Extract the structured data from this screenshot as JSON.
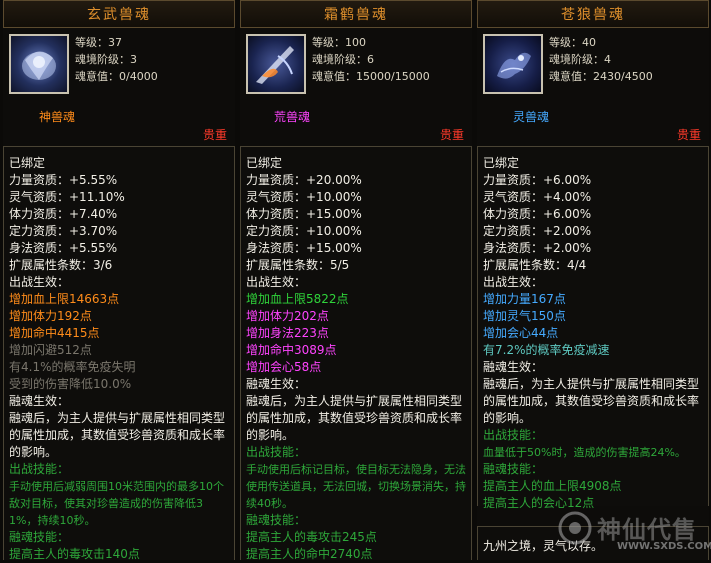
{
  "panels": [
    {
      "title": "玄武兽魂",
      "icon": "black-tortoise-beast-soul-icon",
      "level_label": "等级：37",
      "realm_label": "魂境阶级：3",
      "will_label": "魂意值：0/4000",
      "type_label": "神兽魂",
      "quality_label": "贵重",
      "lines": [
        {
          "text": "已绑定",
          "color": "white"
        },
        {
          "text": "力量资质：+5.55%",
          "color": "white"
        },
        {
          "text": "灵气资质：+11.10%",
          "color": "white"
        },
        {
          "text": "体力资质：+7.40%",
          "color": "white"
        },
        {
          "text": "定力资质：+3.70%",
          "color": "white"
        },
        {
          "text": "身法资质：+5.55%",
          "color": "white"
        },
        {
          "text": "扩展属性条数：3/6",
          "color": "white"
        },
        {
          "text": "出战生效：",
          "color": "white"
        },
        {
          "text": "增加血上限14663点",
          "color": "orange"
        },
        {
          "text": "增加体力192点",
          "color": "orange"
        },
        {
          "text": "增加命中4415点",
          "color": "orange"
        },
        {
          "text": "增加闪避512点",
          "color": "gray"
        },
        {
          "text": "有4.1%的概率免疫失明",
          "color": "gray"
        },
        {
          "text": "受到的伤害降低10.0%",
          "color": "gray"
        },
        {
          "text": "融魂生效：",
          "color": "white"
        },
        {
          "text": "融魂后，为主人提供与扩展属性相同类型的属性加成，其数值受珍兽资质和成长率的影响。",
          "color": "white",
          "wrap": true
        },
        {
          "text": "出战技能：",
          "color": "green2"
        },
        {
          "text": "手动使用后减弱周围10米范围内的最多10个敌对目标，使其对珍兽造成的伤害降低31%，持续10秒。",
          "color": "green2",
          "wrap": true,
          "small": true
        },
        {
          "text": "融魂技能：",
          "color": "green2"
        },
        {
          "text": "提高主人的毒攻击140点",
          "color": "green2"
        }
      ]
    },
    {
      "title": "霜鹤兽魂",
      "icon": "frost-crane-beast-soul-icon",
      "level_label": "等级：100",
      "realm_label": "魂境阶级：6",
      "will_label": "魂意值：15000/15000",
      "type_label": "荒兽魂",
      "quality_label": "贵重",
      "lines": [
        {
          "text": "已绑定",
          "color": "white"
        },
        {
          "text": "力量资质：+20.00%",
          "color": "white"
        },
        {
          "text": "灵气资质：+10.00%",
          "color": "white"
        },
        {
          "text": "体力资质：+15.00%",
          "color": "white"
        },
        {
          "text": "定力资质：+10.00%",
          "color": "white"
        },
        {
          "text": "身法资质：+15.00%",
          "color": "white"
        },
        {
          "text": "扩展属性条数：5/5",
          "color": "white"
        },
        {
          "text": "出战生效：",
          "color": "white"
        },
        {
          "text": "增加血上限5822点",
          "color": "green"
        },
        {
          "text": "增加体力202点",
          "color": "magenta"
        },
        {
          "text": "增加身法223点",
          "color": "magenta"
        },
        {
          "text": "增加命中3089点",
          "color": "magenta"
        },
        {
          "text": "增加会心58点",
          "color": "magenta"
        },
        {
          "text": "融魂生效：",
          "color": "white"
        },
        {
          "text": "融魂后，为主人提供与扩展属性相同类型的属性加成，其数值受珍兽资质和成长率的影响。",
          "color": "white",
          "wrap": true
        },
        {
          "text": "出战技能：",
          "color": "green2"
        },
        {
          "text": "手动使用后标记目标，使目标无法隐身，无法使用传送道具，无法回城，切换场景消失，持续40秒。",
          "color": "green2",
          "wrap": true,
          "small": true
        },
        {
          "text": "融魂技能：",
          "color": "green2"
        },
        {
          "text": "提高主人的毒攻击245点",
          "color": "green2"
        },
        {
          "text": "提高主人的命中2740点",
          "color": "green2"
        }
      ]
    },
    {
      "title": "苍狼兽魂",
      "icon": "azure-wolf-beast-soul-icon",
      "level_label": "等级：40",
      "realm_label": "魂境阶级：4",
      "will_label": "魂意值：2430/4500",
      "type_label": "灵兽魂",
      "quality_label": "贵重",
      "lines": [
        {
          "text": "已绑定",
          "color": "white"
        },
        {
          "text": "力量资质：+6.00%",
          "color": "white"
        },
        {
          "text": "灵气资质：+4.00%",
          "color": "white"
        },
        {
          "text": "体力资质：+6.00%",
          "color": "white"
        },
        {
          "text": "定力资质：+2.00%",
          "color": "white"
        },
        {
          "text": "身法资质：+2.00%",
          "color": "white"
        },
        {
          "text": "扩展属性条数：4/4",
          "color": "white"
        },
        {
          "text": "出战生效：",
          "color": "white"
        },
        {
          "text": "增加力量167点",
          "color": "cyan"
        },
        {
          "text": "增加灵气150点",
          "color": "cyan"
        },
        {
          "text": "增加会心44点",
          "color": "cyan"
        },
        {
          "text": "有7.2%的概率免疫减速",
          "color": "teal"
        },
        {
          "text": "融魂生效：",
          "color": "white"
        },
        {
          "text": "融魂后，为主人提供与扩展属性相同类型的属性加成，其数值受珍兽资质和成长率的影响。",
          "color": "white",
          "wrap": true
        },
        {
          "text": "出战技能：",
          "color": "green2"
        },
        {
          "text": "血量低于50%时，造成的伤害提高24%。",
          "color": "green2",
          "small": true
        },
        {
          "text": "融魂技能：",
          "color": "green2"
        },
        {
          "text": "提高主人的血上限4908点",
          "color": "green2"
        },
        {
          "text": "提高主人的会心12点",
          "color": "green2"
        }
      ]
    }
  ],
  "extra_box": {
    "text": "九州之境，灵气以存。"
  },
  "watermark": {
    "brand": "神仙代售",
    "url": "WWW.SXDS.COM"
  },
  "colors": {
    "title": "#e0902c",
    "quality": "#ff3a2a",
    "orange": "#ff8c1a",
    "green": "#2fd33a",
    "magenta": "#ff44ff",
    "cyan": "#45aaff"
  }
}
